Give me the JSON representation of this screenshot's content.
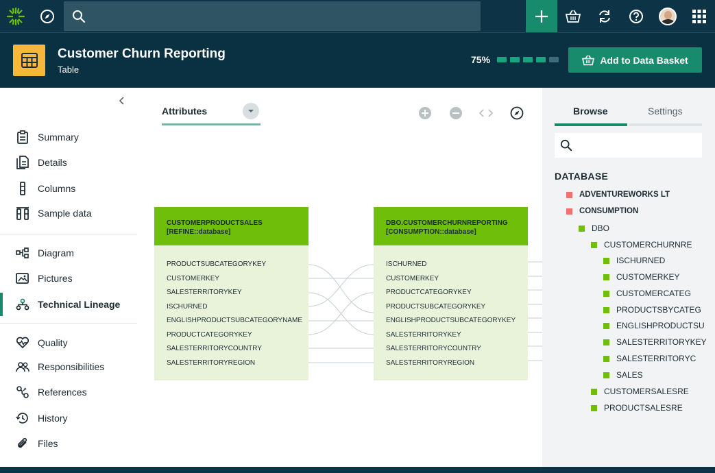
{
  "topbar": {
    "icons": [
      "logo-icon",
      "compass-icon",
      "search-icon",
      "plus-icon",
      "basket-icon",
      "sync-icon",
      "help-icon",
      "avatar",
      "apps-grid-icon"
    ],
    "search_placeholder": ""
  },
  "header": {
    "title": "Customer Churn Reporting",
    "subtitle": "Table",
    "progress_text": "75%",
    "progress_segments_total": 5,
    "progress_segments_filled": 4,
    "basket_label": "Add to Data Basket"
  },
  "sidebar": {
    "items": [
      {
        "label": "Summary",
        "icon": "clipboard-icon"
      },
      {
        "label": "Details",
        "icon": "document-icon"
      },
      {
        "label": "Columns",
        "icon": "columns-icon"
      },
      {
        "label": "Sample data",
        "icon": "sample-data-icon"
      },
      {
        "label": "Diagram",
        "icon": "diagram-icon"
      },
      {
        "label": "Pictures",
        "icon": "pictures-icon"
      },
      {
        "label": "Technical Lineage",
        "icon": "lineage-icon",
        "active": true
      },
      {
        "label": "Quality",
        "icon": "heartbeat-icon"
      },
      {
        "label": "Responsibilities",
        "icon": "people-icon"
      },
      {
        "label": "References",
        "icon": "references-icon"
      },
      {
        "label": "History",
        "icon": "history-icon"
      },
      {
        "label": "Files",
        "icon": "paperclip-icon"
      }
    ]
  },
  "canvas": {
    "attributes_label": "Attributes",
    "left_table": {
      "title_line1": "CUSTOMERPRODUCTSALES",
      "title_line2": "[REFINE::database]",
      "rows": [
        "PRODUCTSUBCATEGORYKEY",
        "CUSTOMERKEY",
        "SALESTERRITORYKEY",
        "ISCHURNED",
        "ENGLISHPRODUCTSUBCATEGORYNAME",
        "PRODUCTCATEGORYKEY",
        "SALESTERRITORYCOUNTRY",
        "SALESTERRITORYREGION"
      ]
    },
    "right_table": {
      "title_line1": "DBO.CUSTOMERCHURNREPORTING",
      "title_line2": "[CONSUMPTION::database]",
      "rows": [
        "ISCHURNED",
        "CUSTOMERKEY",
        "PRODUCTCATEGORYKEY",
        "PRODUCTSUBCATEGORYKEY",
        "ENGLISHPRODUCTSUBCATEGORYKEY",
        "SALESTERRITORYKEY",
        "SALESTERRITORYCOUNTRY",
        "SALESTERRITORYREGION"
      ]
    }
  },
  "right_panel": {
    "tab_browse": "Browse",
    "tab_settings": "Settings",
    "search_placeholder": "",
    "tree_heading": "DATABASE",
    "tree": [
      {
        "label": "ADVENTUREWORKS LT",
        "level": 0,
        "color": "#f0736b",
        "bold": true
      },
      {
        "label": "CONSUMPTION",
        "level": 0,
        "color": "#f0736b",
        "bold": true
      },
      {
        "label": "DBO",
        "level": 1,
        "color": "#6fbe0a"
      },
      {
        "label": "CUSTOMERCHURNRE",
        "level": 2,
        "color": "#6fbe0a"
      },
      {
        "label": "ISCHURNED",
        "level": 3,
        "color": "#6fbe0a"
      },
      {
        "label": "CUSTOMERKEY",
        "level": 3,
        "color": "#6fbe0a"
      },
      {
        "label": "CUSTOMERCATEG",
        "level": 3,
        "color": "#6fbe0a"
      },
      {
        "label": "PRODUCTSBYCATEG",
        "level": 3,
        "color": "#6fbe0a"
      },
      {
        "label": "ENGLISHPRODUCTSU",
        "level": 3,
        "color": "#6fbe0a"
      },
      {
        "label": "SALESTERRITORYKEY",
        "level": 3,
        "color": "#6fbe0a"
      },
      {
        "label": "SALESTERRITORYC",
        "level": 3,
        "color": "#6fbe0a"
      },
      {
        "label": "SALES",
        "level": 3,
        "color": "#6fbe0a"
      },
      {
        "label": "CUSTOMERSALESRE",
        "level": 2,
        "color": "#6fbe0a"
      },
      {
        "label": "PRODUCTSALESRE",
        "level": 2,
        "color": "#6fbe0a"
      }
    ]
  }
}
